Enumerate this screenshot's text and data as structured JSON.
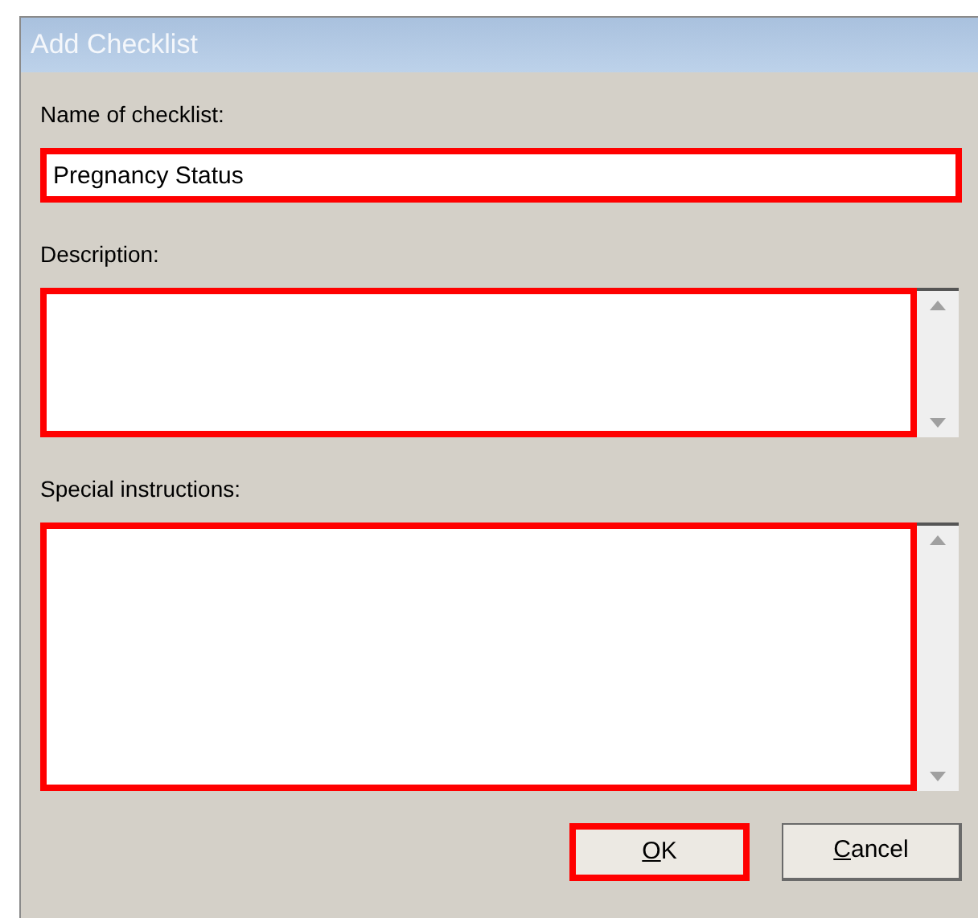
{
  "window": {
    "title": "Add Checklist"
  },
  "fields": [
    {
      "kind": "line",
      "label": "Name of checklist:",
      "value": "Pregnancy Status",
      "highlighted": true
    },
    {
      "kind": "multiline",
      "label": "Description:",
      "highlighted": true
    },
    {
      "kind": "multiline",
      "label": "Special instructions:",
      "highlighted": true
    }
  ],
  "buttons": [
    {
      "access_key": "O",
      "rest": "K",
      "highlighted": true
    },
    {
      "access_key": "C",
      "rest": "ancel",
      "highlighted": false
    }
  ]
}
